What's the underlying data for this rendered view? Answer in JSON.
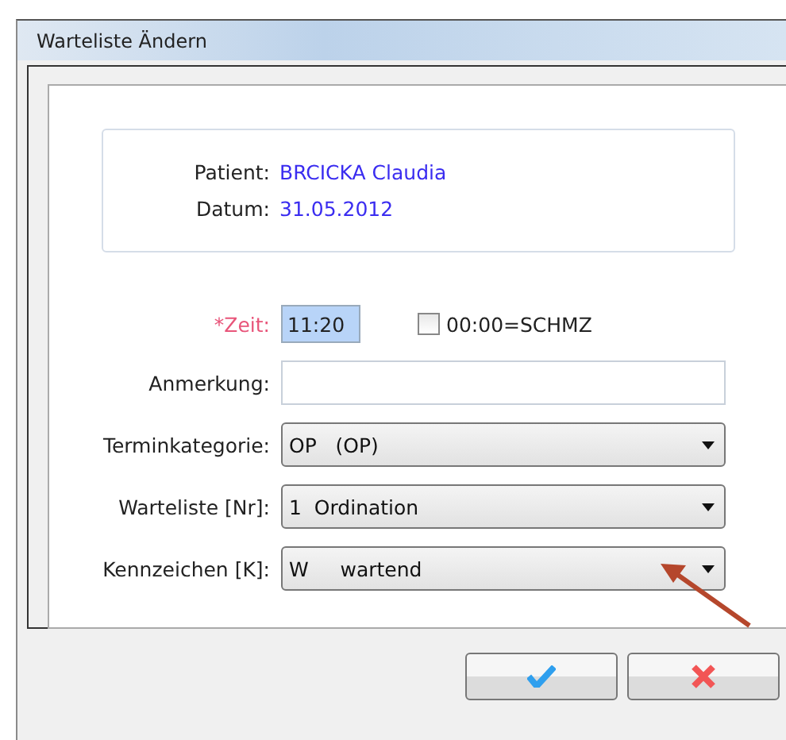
{
  "window": {
    "title": "Warteliste Ändern"
  },
  "info": [
    {
      "label": "Patient:",
      "value": "BRCICKA Claudia"
    },
    {
      "label": "Datum:",
      "value": "31.05.2012"
    }
  ],
  "time": {
    "label": "*Zeit:",
    "value": "11:20",
    "required": true,
    "checkbox": {
      "label": "00:00=SCHMZ",
      "checked": false
    }
  },
  "fields": [
    {
      "kind": "text",
      "label": "Anmerkung:"
    },
    {
      "kind": "select",
      "label": "Terminkategorie:",
      "value": "OP   (OP)"
    },
    {
      "kind": "select",
      "label": "Warteliste [Nr]:",
      "value": "1  Ordination"
    },
    {
      "kind": "select",
      "label": "Kennzeichen [K]:",
      "value": "W     wartend"
    }
  ],
  "buttons": [
    {
      "kind": "ok"
    },
    {
      "kind": "cancel"
    }
  ]
}
